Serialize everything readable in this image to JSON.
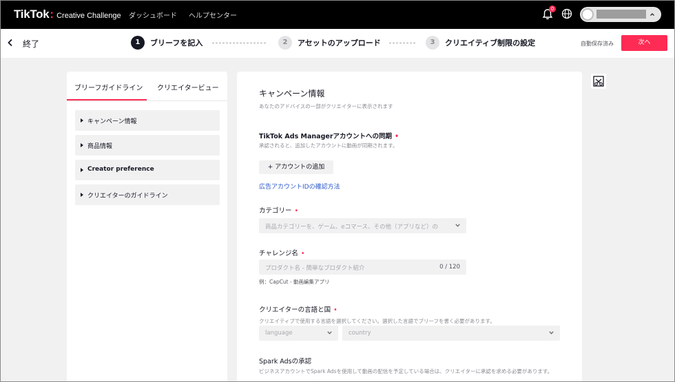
{
  "header": {
    "brand_logo": "TikTok",
    "brand_colon": ":",
    "brand_sub": "Creative Challenge",
    "nav": [
      "ダッシュボード",
      "ヘルプセンター"
    ],
    "notification_count": "0",
    "icons": [
      "bell-icon",
      "globe-icon",
      "chevron-up-icon"
    ]
  },
  "stepbar": {
    "exit_label": "終了",
    "steps": [
      {
        "num": "1",
        "label": "ブリーフを記入",
        "state": "active"
      },
      {
        "num": "2",
        "label": "アセットのアップロード",
        "state": "idle"
      },
      {
        "num": "3",
        "label": "クリエイティブ制限の設定",
        "state": "idle"
      }
    ],
    "autosave": "自動保存済み",
    "next_label": "次へ"
  },
  "left_panel": {
    "tabs": [
      "ブリーフガイドライン",
      "クリエイタービュー"
    ],
    "items": [
      "キャンペーン情報",
      "商品情報",
      "Creator preference",
      "クリエイターのガイドライン"
    ]
  },
  "form": {
    "section_title": "キャンペーン情報",
    "section_sub": "あなたのアドバイスの一部がクリエイターに表示されます",
    "ads_label": "TikTok Ads Managerアカウントへの同期",
    "ads_help": "承認されると、追加したアカウントに動画が同期されます。",
    "add_account": "+ アカウントの追加",
    "ad_id_link": "広告アカウントIDの確認方法",
    "category_label": "カテゴリー",
    "category_placeholder": "商品カテゴリーを、ゲーム、eコマース、その他（アプリなど）の",
    "challenge_label": "チャレンジ名",
    "challenge_placeholder": "プロダクト名 - 簡単なプロダクト紹介",
    "challenge_counter": "0 / 120",
    "challenge_example": "例：CapCut - 動画編集アプリ",
    "lang_label": "クリエイターの言語と国",
    "lang_help": "クリエイティブで使用する言語を選択してください。選択した言語でブリーフを書く必要があります。",
    "language_placeholder": "language",
    "country_placeholder": "country",
    "spark_label": "Spark Adsの承認",
    "spark_help": "ビジネスアカウントでSpark Adsを使用して動画の配信を予定している場合は、クリエイターに承認を求める必要があります。"
  },
  "colors": {
    "accent": "#fe2c55",
    "link": "#2b5ac9",
    "nav_bg": "#000000"
  }
}
